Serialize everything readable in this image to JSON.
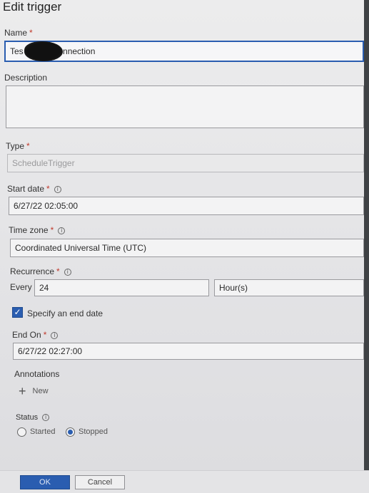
{
  "dialog": {
    "title": "Edit trigger"
  },
  "name": {
    "label": "Name",
    "value_prefix": "Tes",
    "value_suffix": "Connection"
  },
  "description": {
    "label": "Description",
    "value": ""
  },
  "type": {
    "label": "Type",
    "value": "ScheduleTrigger"
  },
  "start_date": {
    "label": "Start date",
    "value": "6/27/22 02:05:00"
  },
  "time_zone": {
    "label": "Time zone",
    "value": "Coordinated Universal Time (UTC)"
  },
  "recurrence": {
    "label": "Recurrence",
    "every_label": "Every",
    "interval": "24",
    "unit": "Hour(s)"
  },
  "end_date_toggle": {
    "label": "Specify an end date",
    "checked": true
  },
  "end_on": {
    "label": "End On",
    "value": "6/27/22 02:27:00"
  },
  "annotations": {
    "label": "Annotations",
    "new_label": "New"
  },
  "status": {
    "label": "Status",
    "options": [
      "Started",
      "Stopped"
    ],
    "selected": "Stopped"
  },
  "footer": {
    "ok_label": "OK",
    "cancel_label": "Cancel"
  },
  "colors": {
    "accent": "#2a5db0",
    "required": "#c0392b"
  },
  "icons": {
    "info": "info-icon",
    "plus": "plus-icon",
    "check": "checkmark-icon"
  }
}
